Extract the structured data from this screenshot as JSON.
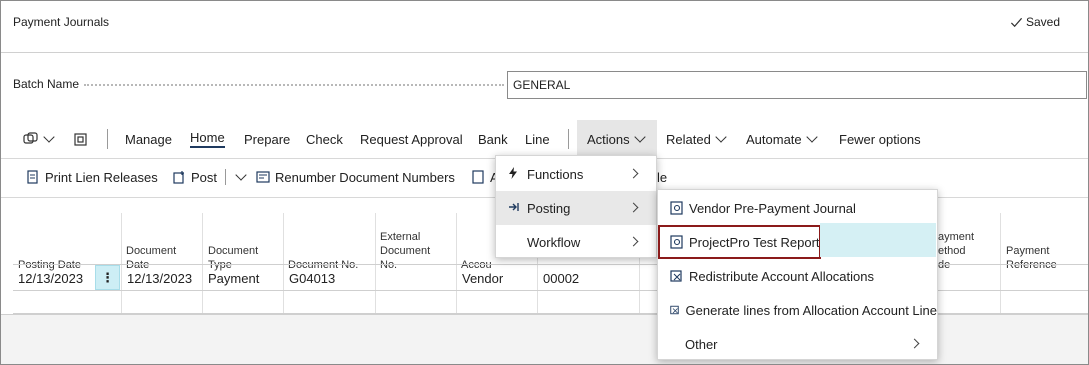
{
  "page": {
    "title": "Payment Journals",
    "saved_label": "Saved"
  },
  "batch": {
    "label": "Batch Name",
    "value": "GENERAL"
  },
  "actionbar": {
    "items": [
      "Manage",
      "Home",
      "Prepare",
      "Check",
      "Request Approval",
      "Bank",
      "Line"
    ],
    "active": "Home",
    "actions_label": "Actions",
    "related_label": "Related",
    "automate_label": "Automate",
    "fewer_label": "Fewer options"
  },
  "subbar": {
    "print_lien": "Print Lien Releases",
    "post": "Post",
    "renumber": "Renumber Document Numbers",
    "partial_a": "A",
    "partial_le": "le"
  },
  "grid": {
    "headers": {
      "posting_date": "Posting Date",
      "document_date": "Document Date",
      "document_type": "Document Type",
      "document_no": "Document No.",
      "external_document_no": "External Document No.",
      "account": "Accou",
      "payment_method": "ayment ethod de",
      "payment_reference": "Payment Reference"
    },
    "rows": [
      {
        "posting_date": "12/13/2023",
        "document_date": "12/13/2023",
        "document_type": "Payment",
        "document_no": "G04013",
        "account_type": "Vendor",
        "account_no": "00002"
      }
    ]
  },
  "actions_menu": {
    "items": [
      {
        "label": "Functions",
        "icon": "lightning-icon"
      },
      {
        "label": "Posting",
        "icon": "post-icon"
      },
      {
        "label": "Workflow",
        "icon": ""
      }
    ],
    "highlighted": "Posting"
  },
  "posting_submenu": {
    "items": [
      "Vendor Pre-Payment Journal",
      "ProjectPro Test Report",
      "Redistribute Account Allocations",
      "Generate lines from Allocation Account Line",
      "Other"
    ],
    "highlighted": "ProjectPro Test Report",
    "highlight_color": "#d5f0f4",
    "box_color": "#8b1a1a"
  }
}
